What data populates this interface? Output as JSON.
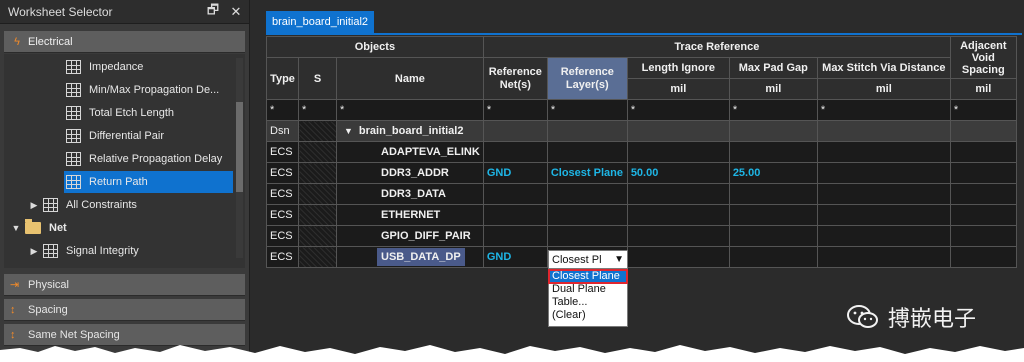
{
  "worksheet": {
    "title": "Worksheet Selector",
    "restore_icon": "🗗",
    "close_icon": "✕",
    "electrical_label": "Electrical",
    "tree": [
      {
        "label": "Impedance"
      },
      {
        "label": "Min/Max Propagation De..."
      },
      {
        "label": "Total Etch Length"
      },
      {
        "label": "Differential Pair"
      },
      {
        "label": "Relative Propagation Delay"
      },
      {
        "label": "Return Path"
      },
      {
        "label": "All Constraints"
      },
      {
        "label": "Net"
      },
      {
        "label": "Signal Integrity"
      }
    ],
    "physical_label": "Physical",
    "spacing_label": "Spacing",
    "same_net_label": "Same Net Spacing"
  },
  "doc_tab": "brain_board_initial2",
  "table": {
    "h_objects": "Objects",
    "h_trace_ref": "Trace Reference",
    "h_adjacent": "Adjacent Void Spacing",
    "h_type": "Type",
    "h_s": "S",
    "h_name": "Name",
    "h_ref_nets": "Reference Net(s)",
    "h_ref_layers": "Reference Layer(s)",
    "h_len_ignore": "Length Ignore",
    "h_max_pad": "Max Pad Gap",
    "h_max_stitch": "Max Stitch Via Distance",
    "unit": "mil",
    "filter": "*",
    "rows": [
      {
        "type": "Dsn",
        "name": "brain_board_initial2",
        "ref_nets": "",
        "ref_layers": "",
        "len_ignore": "",
        "max_pad": ""
      },
      {
        "type": "ECS",
        "name": "ADAPTEVA_ELINK",
        "ref_nets": "",
        "ref_layers": "",
        "len_ignore": "",
        "max_pad": ""
      },
      {
        "type": "ECS",
        "name": "DDR3_ADDR",
        "ref_nets": "GND",
        "ref_layers": "Closest Plane",
        "len_ignore": "50.00",
        "max_pad": "25.00"
      },
      {
        "type": "ECS",
        "name": "DDR3_DATA",
        "ref_nets": "",
        "ref_layers": "",
        "len_ignore": "",
        "max_pad": ""
      },
      {
        "type": "ECS",
        "name": "ETHERNET",
        "ref_nets": "",
        "ref_layers": "",
        "len_ignore": "",
        "max_pad": ""
      },
      {
        "type": "ECS",
        "name": "GPIO_DIFF_PAIR",
        "ref_nets": "",
        "ref_layers": "",
        "len_ignore": "",
        "max_pad": ""
      },
      {
        "type": "ECS",
        "name": "USB_DATA_DP",
        "ref_nets": "GND",
        "ref_layers": "",
        "len_ignore": "",
        "max_pad": ""
      }
    ]
  },
  "dropdown": {
    "value": "Closest Pl",
    "options": [
      "Closest Plane",
      "Dual Plane",
      "Table...",
      "(Clear)"
    ]
  },
  "watermark": "搏嵌电子",
  "colors": {
    "accent": "#0f72cf",
    "value_blue": "#1eb6e6",
    "highlight_red": "#e0262f"
  }
}
